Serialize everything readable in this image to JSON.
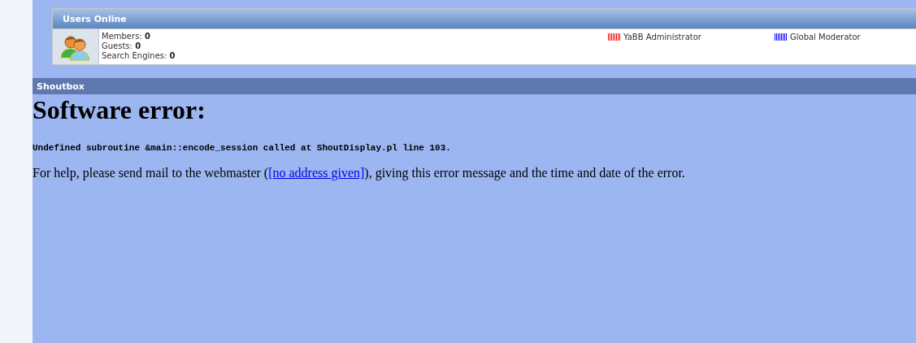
{
  "users_online": {
    "title": "Users Online",
    "stats": [
      {
        "label": "Members:",
        "value": "0"
      },
      {
        "label": "Guests:",
        "value": "0"
      },
      {
        "label": "Search Engines:",
        "value": "0"
      }
    ],
    "legend": [
      {
        "label": "YaBB Administrator",
        "color": "#ff0000"
      },
      {
        "label": "Global Moderator",
        "color": "#0000ff"
      }
    ]
  },
  "shoutbox": {
    "title": "Shoutbox"
  },
  "error": {
    "heading": "Software error:",
    "message": "Undefined subroutine &main::encode_session called at ShoutDisplay.pl line 103.",
    "help_before": "For help, please send mail to the webmaster (",
    "help_link": "[no address given]",
    "help_after": "), giving this error message and the time and date of the error."
  }
}
